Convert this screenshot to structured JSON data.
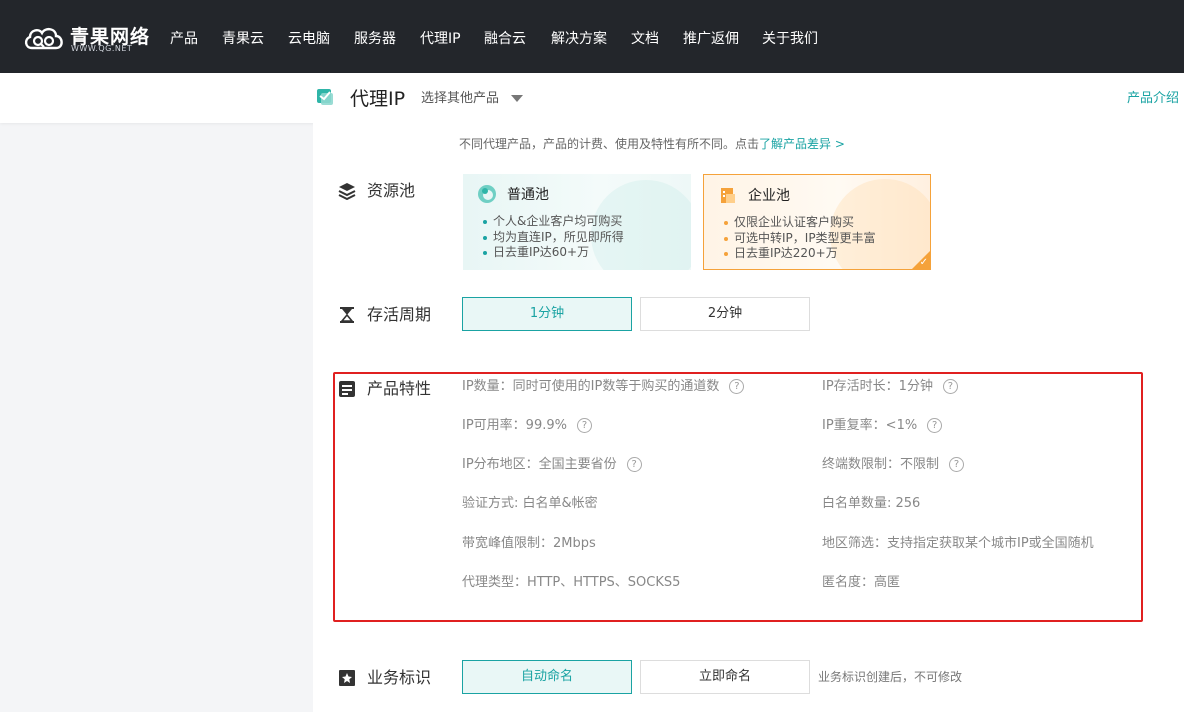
{
  "brand": {
    "name": "青果网络",
    "sub": "WWW.QG.NET"
  },
  "nav": [
    "产品",
    "青果云",
    "云电脑",
    "服务器",
    "代理IP",
    "融合云",
    "解决方案",
    "文档",
    "推广返佣",
    "关于我们"
  ],
  "subheader": {
    "title": "代理IP",
    "select_label": "选择其他产品",
    "intro_link": "产品介绍"
  },
  "hint": {
    "text": "不同代理产品，产品的计费、使用及特性有所不同。点击",
    "link": "了解产品差异 >"
  },
  "sections": {
    "pool": "资源池",
    "cycle": "存活周期",
    "features": "产品特性",
    "identifier": "业务标识"
  },
  "pools": [
    {
      "name": "普通池",
      "points": [
        "个人&企业客户均可购买",
        "均为直连IP，所见即所得",
        "日去重IP达60+万"
      ],
      "selected": false
    },
    {
      "name": "企业池",
      "points": [
        "仅限企业认证客户购买",
        "可选中转IP，IP类型更丰富",
        "日去重IP达220+万"
      ],
      "selected": true
    }
  ],
  "cycle_options": [
    {
      "label": "1分钟",
      "active": true
    },
    {
      "label": "2分钟",
      "active": false
    }
  ],
  "features_left": [
    "IP数量：同时可使用的IP数等于购买的通道数",
    "IP可用率：99.9%",
    "IP分布地区：全国主要省份",
    "验证方式:  白名单&帐密",
    "带宽峰值限制：2Mbps",
    "代理类型：HTTP、HTTPS、SOCKS5"
  ],
  "features_right": [
    "IP存活时长：1分钟",
    "IP重复率：<1%",
    "终端数限制：不限制",
    "白名单数量:  256",
    "地区筛选：支持指定获取某个城市IP或全国随机",
    "匿名度：高匿"
  ],
  "help_glyph": "?",
  "identifier_options": [
    {
      "label": "自动命名",
      "active": true
    },
    {
      "label": "立即命名",
      "active": false
    }
  ],
  "identifier_tip": "业务标识创建后，不可修改",
  "colors": {
    "accent": "#1aa3a3",
    "enterprise": "#f5a23a",
    "highlight_box": "#e02020",
    "nav_bg": "#23262b"
  }
}
